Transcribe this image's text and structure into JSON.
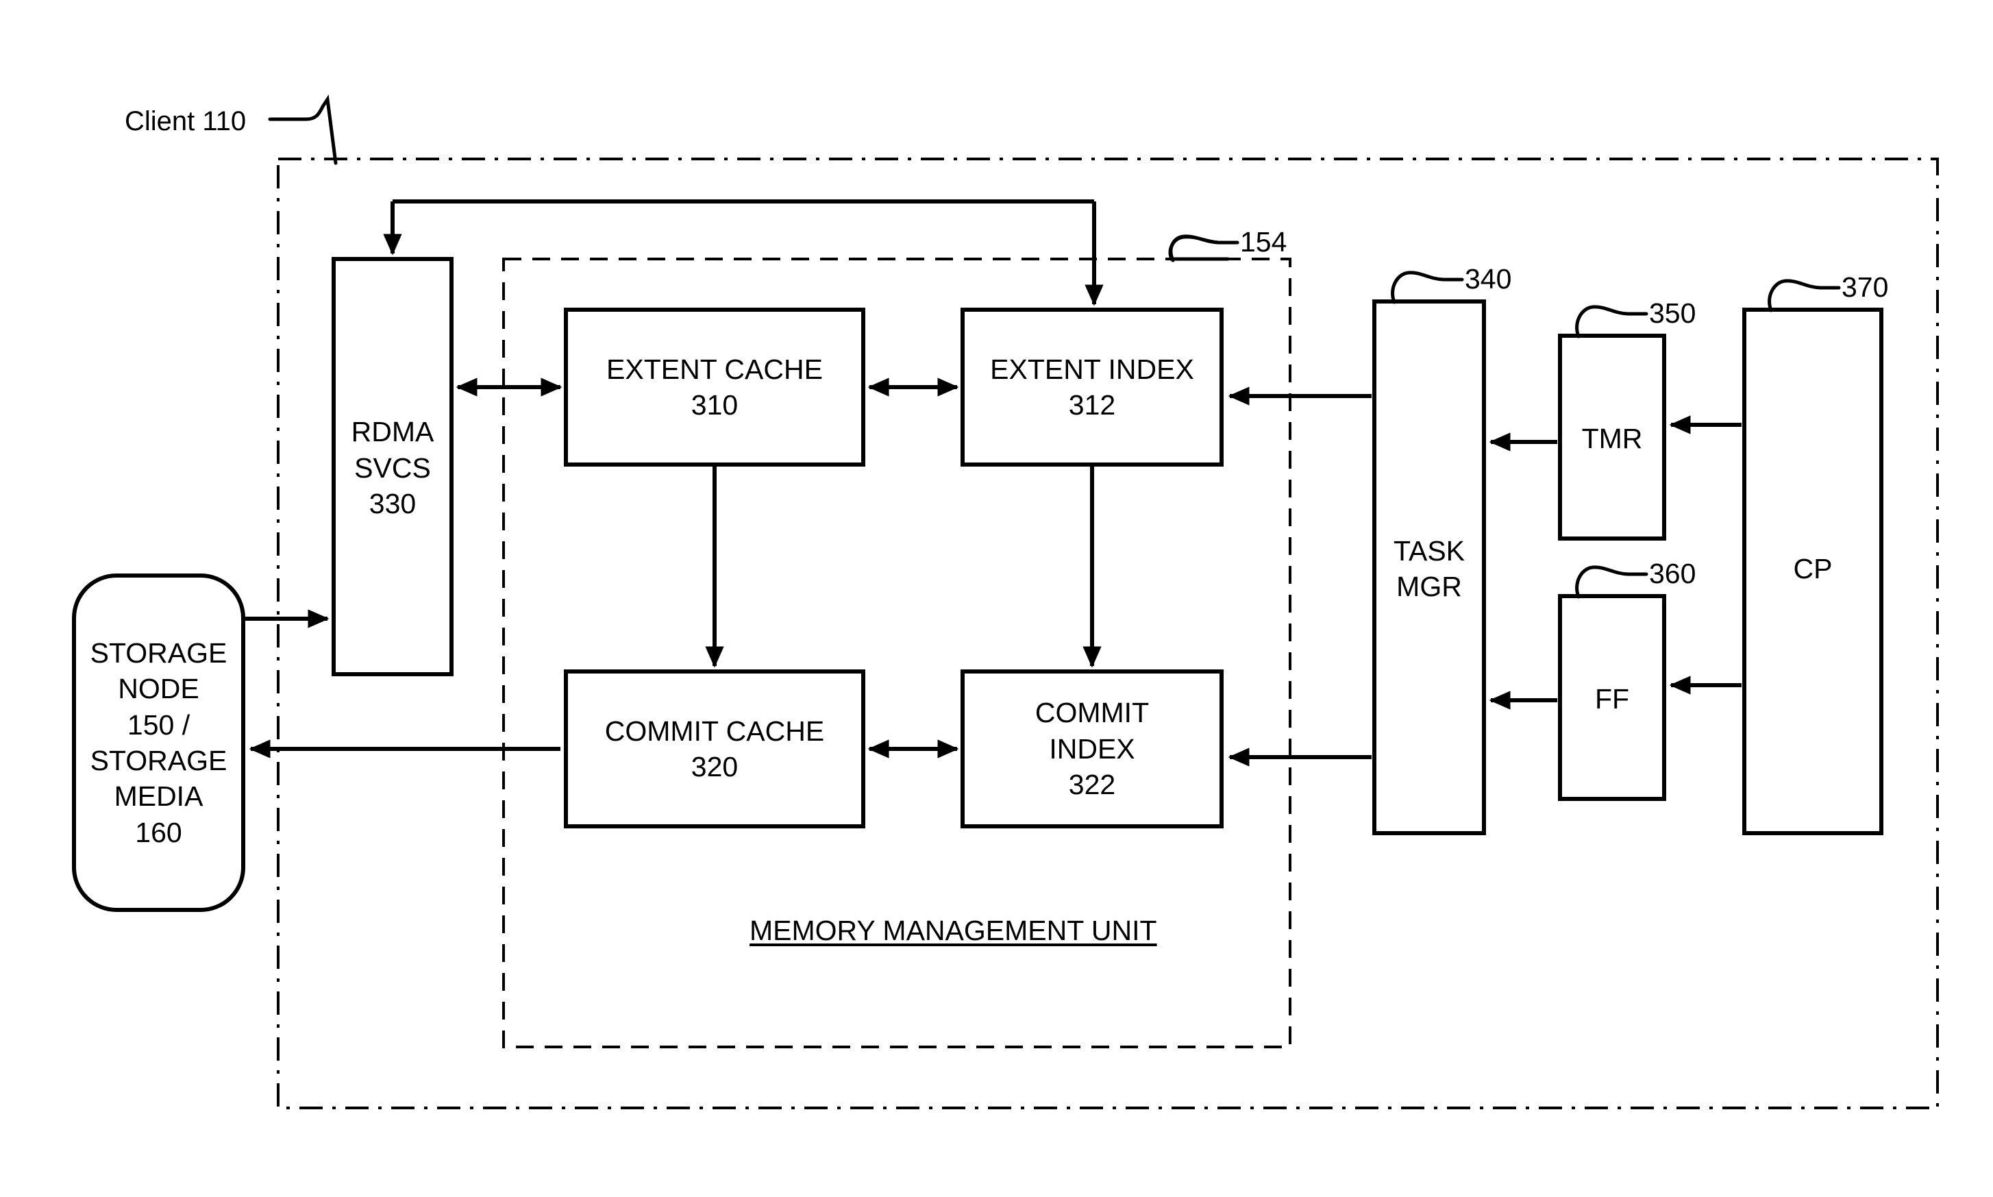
{
  "figure": {
    "kind": "patent-block-diagram",
    "background_color": "#ffffff",
    "line_color": "#000000",
    "client_label": "Client 110",
    "mmu_caption": "MEMORY MANAGEMENT UNIT",
    "mmu_ref": "154"
  },
  "blocks": {
    "storage": {
      "name": "storage-node",
      "lines": [
        "STORAGE",
        "NODE",
        "150 /",
        "STORAGE",
        "MEDIA",
        "160"
      ],
      "shape": "rounded-rect"
    },
    "rdma": {
      "name": "rdma-svcs",
      "lines": [
        "RDMA",
        "SVCS",
        "330"
      ],
      "shape": "rect",
      "ref": "330"
    },
    "extent_cache": {
      "name": "extent-cache",
      "lines": [
        "EXTENT CACHE",
        "310"
      ],
      "shape": "rect",
      "ref": "310"
    },
    "extent_index": {
      "name": "extent-index",
      "lines": [
        "EXTENT INDEX",
        "312"
      ],
      "shape": "rect",
      "ref": "312"
    },
    "commit_cache": {
      "name": "commit-cache",
      "lines": [
        "COMMIT CACHE",
        "320"
      ],
      "shape": "rect",
      "ref": "320"
    },
    "commit_index": {
      "name": "commit-index",
      "lines": [
        "COMMIT",
        "INDEX",
        "322"
      ],
      "shape": "rect",
      "ref": "322"
    },
    "task_mgr": {
      "name": "task-mgr",
      "lines": [
        "TASK",
        "MGR"
      ],
      "shape": "rect",
      "ref": "340"
    },
    "tmr": {
      "name": "tmr",
      "lines": [
        "TMR"
      ],
      "shape": "rect",
      "ref": "350"
    },
    "ff": {
      "name": "ff",
      "lines": [
        "FF"
      ],
      "shape": "rect",
      "ref": "360"
    },
    "cp": {
      "name": "cp",
      "lines": [
        "CP"
      ],
      "shape": "rect",
      "ref": "370"
    }
  },
  "reference_numerals": {
    "client": "110",
    "mmu": "154",
    "extent_cache": "310",
    "extent_index": "312",
    "commit_cache": "320",
    "commit_index": "322",
    "rdma_svcs": "330",
    "task_mgr": "340",
    "tmr": "350",
    "ff": "360",
    "cp": "370",
    "storage_node": "150",
    "storage_media": "160"
  },
  "connections": [
    {
      "from": "storage-node",
      "to": "rdma-svcs",
      "arrows": "end"
    },
    {
      "from": "extent-index",
      "to": "rdma-svcs",
      "arrows": "both-down"
    },
    {
      "from": "rdma-svcs",
      "to": "extent-cache",
      "arrows": "both"
    },
    {
      "from": "extent-cache",
      "to": "extent-index",
      "arrows": "both"
    },
    {
      "from": "extent-cache",
      "to": "commit-cache",
      "arrows": "end"
    },
    {
      "from": "extent-index",
      "to": "commit-index",
      "arrows": "end"
    },
    {
      "from": "commit-cache",
      "to": "storage-node",
      "arrows": "end"
    },
    {
      "from": "commit-cache",
      "to": "commit-index",
      "arrows": "both"
    },
    {
      "from": "task-mgr",
      "to": "extent-index",
      "arrows": "end"
    },
    {
      "from": "task-mgr",
      "to": "commit-index",
      "arrows": "end"
    },
    {
      "from": "tmr",
      "to": "task-mgr",
      "arrows": "end"
    },
    {
      "from": "ff",
      "to": "task-mgr",
      "arrows": "end"
    },
    {
      "from": "cp",
      "to": "tmr",
      "arrows": "end"
    },
    {
      "from": "cp",
      "to": "ff",
      "arrows": "end"
    }
  ]
}
